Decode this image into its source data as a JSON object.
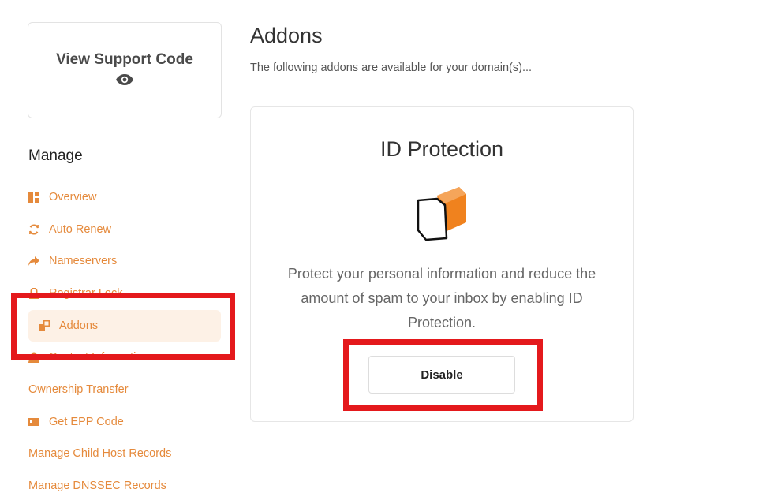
{
  "support": {
    "title": "View Support Code",
    "icon": "eye-icon"
  },
  "sidebar": {
    "heading": "Manage",
    "items": [
      {
        "label": "Overview",
        "icon": "dashboard-icon"
      },
      {
        "label": "Auto Renew",
        "icon": "refresh-icon"
      },
      {
        "label": "Nameservers",
        "icon": "share-arrow-icon"
      },
      {
        "label": "Registrar Lock",
        "icon": "lock-icon"
      },
      {
        "label": "Addons",
        "icon": "cubes-icon",
        "active": true
      },
      {
        "label": "Contact Information",
        "icon": "user-icon"
      },
      {
        "label": "Ownership Transfer"
      },
      {
        "label": "Get EPP Code",
        "icon": "id-card-icon"
      },
      {
        "label": "Manage Child Host Records"
      },
      {
        "label": "Manage DNSSEC Records"
      }
    ]
  },
  "main": {
    "title": "Addons",
    "subtitle": "The following addons are available for your domain(s)...",
    "addon": {
      "title": "ID Protection",
      "icon": "shield-icon",
      "description": "Protect your personal information and reduce the amount of spam to your inbox by enabling ID Protection.",
      "button_label": "Disable"
    }
  },
  "colors": {
    "accent": "#e58a3c",
    "active_bg": "#fdf1e6",
    "highlight": "#e4191c"
  }
}
